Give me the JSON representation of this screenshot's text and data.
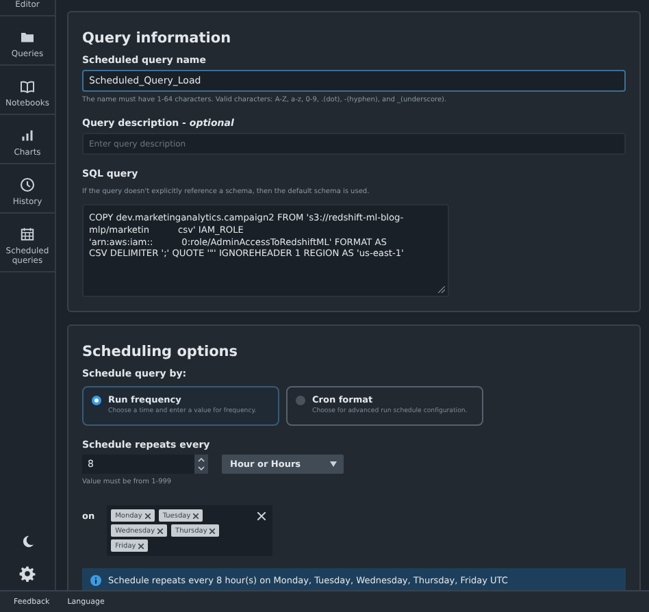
{
  "sidebar": {
    "items": [
      {
        "label": "Editor"
      },
      {
        "label": "Queries"
      },
      {
        "label": "Notebooks"
      },
      {
        "label": "Charts"
      },
      {
        "label": "History"
      },
      {
        "label": "Scheduled queries"
      }
    ]
  },
  "query_information": {
    "title": "Query information",
    "name": {
      "label": "Scheduled query name",
      "value": "Scheduled_Query_Load",
      "hint": "The name must have 1-64 characters. Valid characters: A-Z, a-z, 0-9, .(dot), -(hyphen), and _(underscore)."
    },
    "description": {
      "label": "Query description - ",
      "optional": "optional",
      "placeholder": "Enter query description"
    },
    "sql": {
      "label": "SQL query",
      "hint": "If the query doesn't explicitly reference a schema, then the default schema is used.",
      "lines": [
        "COPY dev.marketinganalytics.campaign2 FROM 's3://redshift-ml-blog-",
        "mlp/marketin          csv' IAM_ROLE",
        "'arn:aws:iam::          0:role/AdminAccessToRedshiftML' FORMAT AS",
        "CSV DELIMITER ';' QUOTE '\"' IGNOREHEADER 1 REGION AS 'us-east-1'"
      ]
    }
  },
  "scheduling_options": {
    "title": "Scheduling options",
    "schedule_by_label": "Schedule query by:",
    "options": [
      {
        "label": "Run frequency",
        "description": "Choose a time and enter a value for frequency.",
        "selected": true
      },
      {
        "label": "Cron format",
        "description": "Choose for advanced run schedule configuration.",
        "selected": false
      }
    ],
    "repeats_label": "Schedule repeats every",
    "value": "8",
    "unit": "Hour or Hours",
    "value_hint": "Value must be from 1-999",
    "on_label": "on",
    "days": [
      "Monday",
      "Tuesday",
      "Wednesday",
      "Thursday",
      "Friday"
    ],
    "info": "Schedule repeats every 8 hour(s) on Monday, Tuesday, Wednesday, Thursday, Friday UTC"
  },
  "footer": {
    "links": [
      "Feedback",
      "Language"
    ]
  }
}
